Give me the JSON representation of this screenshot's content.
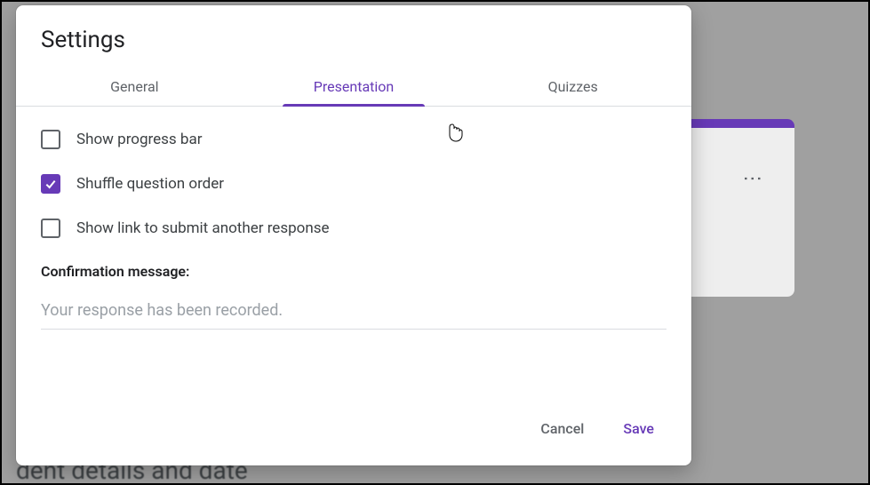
{
  "dialog": {
    "title": "Settings",
    "tabs": {
      "general": "General",
      "presentation": "Presentation",
      "quizzes": "Quizzes"
    },
    "options": {
      "show_progress_bar": {
        "label": "Show progress bar",
        "checked": false
      },
      "shuffle_question_order": {
        "label": "Shuffle question order",
        "checked": true
      },
      "show_submit_link": {
        "label": "Show link to submit another response",
        "checked": false
      }
    },
    "confirmation": {
      "section_label": "Confirmation message:",
      "placeholder": "Your response has been recorded.",
      "value": ""
    },
    "actions": {
      "cancel": "Cancel",
      "save": "Save"
    }
  },
  "background": {
    "partial_text": "dent details and date"
  }
}
